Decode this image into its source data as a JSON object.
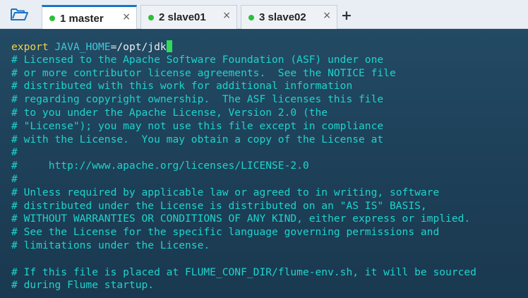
{
  "tabs": [
    {
      "label": "1 master",
      "active": true,
      "close": "×",
      "dot_color": "#2bbf3c"
    },
    {
      "label": "2 slave01",
      "active": false,
      "close": "×",
      "dot_color": "#2bbf3c"
    },
    {
      "label": "3 slave02",
      "active": false,
      "close": "×",
      "dot_color": "#2bbf3c"
    }
  ],
  "add_tab": "+",
  "terminal": {
    "first_line": {
      "keyword": "export",
      "variable": "JAVA_HOME",
      "value": "=/opt/jdk"
    },
    "comments": [
      "# Licensed to the Apache Software Foundation (ASF) under one",
      "# or more contributor license agreements.  See the NOTICE file",
      "# distributed with this work for additional information",
      "# regarding copyright ownership.  The ASF licenses this file",
      "# to you under the Apache License, Version 2.0 (the",
      "# \"License\"); you may not use this file except in compliance",
      "# with the License.  You may obtain a copy of the License at",
      "#",
      "#     http://www.apache.org/licenses/LICENSE-2.0",
      "#",
      "# Unless required by applicable law or agreed to in writing, software",
      "# distributed under the License is distributed on an \"AS IS\" BASIS,",
      "# WITHOUT WARRANTIES OR CONDITIONS OF ANY KIND, either express or implied.",
      "# See the License for the specific language governing permissions and",
      "# limitations under the License.",
      "",
      "# If this file is placed at FLUME_CONF_DIR/flume-env.sh, it will be sourced",
      "# during Flume startup."
    ]
  },
  "colors": {
    "accent": "#1b73c9",
    "terminal_bg": "#1f4057",
    "comment": "#1fd3cc",
    "keyword": "#f1d14c",
    "cursor": "#2ddc5a"
  },
  "icons": {
    "open": "folder-open-icon",
    "close": "close-icon",
    "add": "plus-icon"
  }
}
